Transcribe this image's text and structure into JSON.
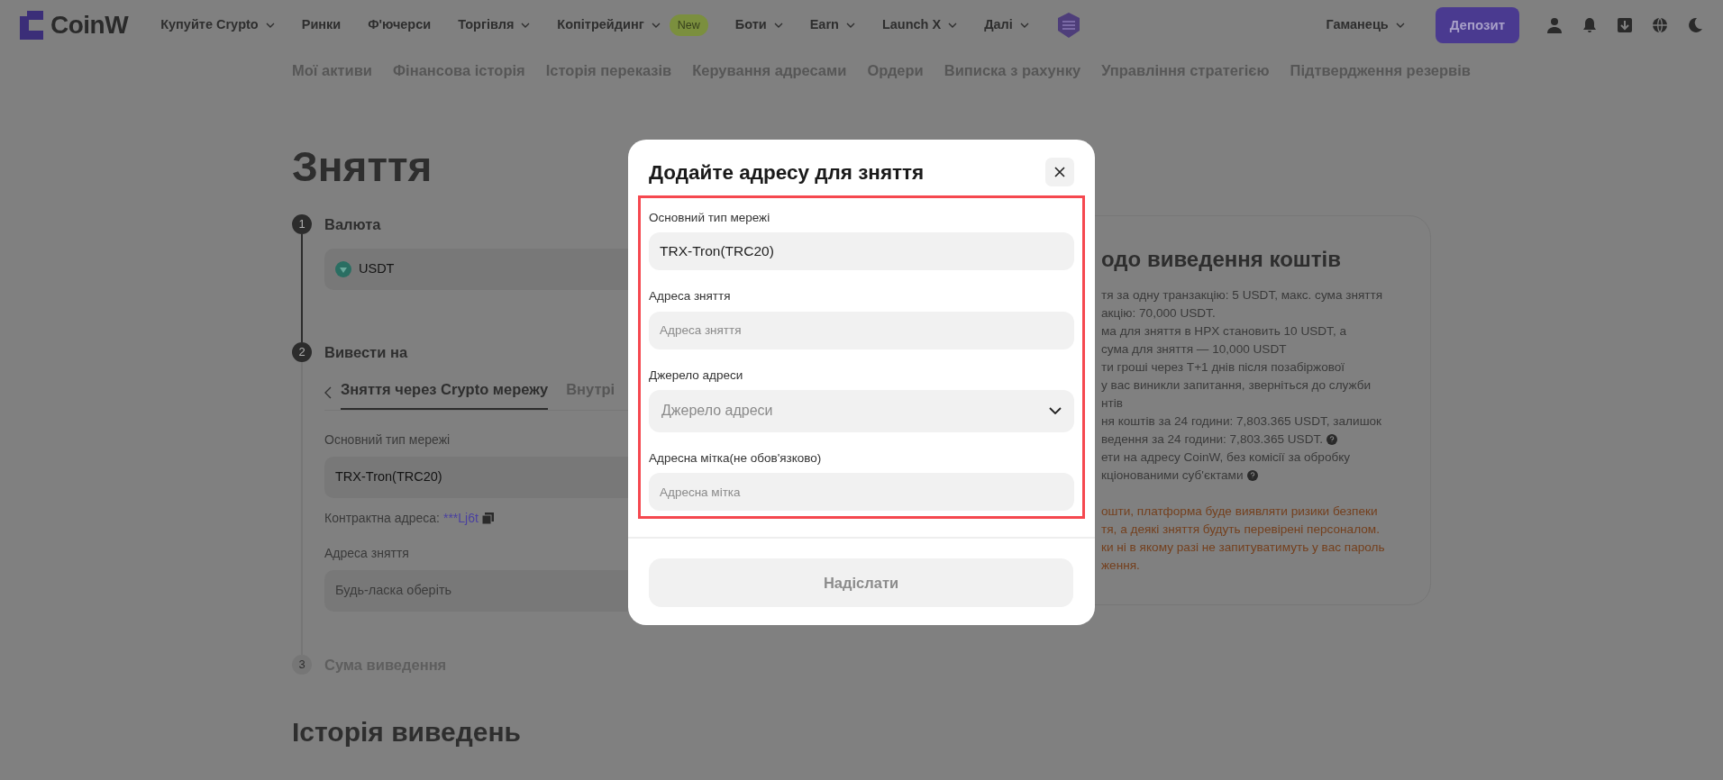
{
  "navbar": {
    "logo": "CoinW",
    "menu": [
      {
        "label": "Купуйте Crypto",
        "dropdown": true
      },
      {
        "label": "Ринки",
        "dropdown": false
      },
      {
        "label": "Ф'ючерси",
        "dropdown": false
      },
      {
        "label": "Торгівля",
        "dropdown": true
      },
      {
        "label": "Копітрейдинг",
        "dropdown": true,
        "badge": "New"
      },
      {
        "label": "Боти",
        "dropdown": true
      },
      {
        "label": "Earn",
        "dropdown": true
      },
      {
        "label": "Launch X",
        "dropdown": true
      },
      {
        "label": "Далі",
        "dropdown": true
      }
    ],
    "wallet": {
      "label": "Гаманець",
      "dropdown": true
    },
    "deposit": "Депозит"
  },
  "subnav": [
    "Мої активи",
    "Фінансова історія",
    "Історія переказів",
    "Керування адресами",
    "Ордери",
    "Виписка з рахунку",
    "Управління стратегією",
    "Підтвердження резервів"
  ],
  "page_title": "Зняття",
  "steps": [
    {
      "number": "1",
      "title": "Валюта",
      "active": true
    },
    {
      "number": "2",
      "title": "Вивести на",
      "active": true
    },
    {
      "number": "3",
      "title": "Сума виведення",
      "active": false
    }
  ],
  "currency": {
    "value": "USDT"
  },
  "withdraw_tabs": [
    {
      "label": "Зняття через Crypto мережу",
      "selected": true
    },
    {
      "label": "Внутрі",
      "selected": false
    }
  ],
  "network": {
    "label": "Основний тип мережі",
    "value": "TRX-Tron(TRC20)"
  },
  "contract": {
    "label": "Контрактна адреса:",
    "value": "***Lj6t"
  },
  "address": {
    "label": "Адреса зняття",
    "placeholder": "Будь-ласка оберіть"
  },
  "info_panel": {
    "title": "одо виведення коштів",
    "lines": [
      {
        "text": "тя за одну транзакцію: 5 USDT, макс. сума зняття",
        "help": false
      },
      {
        "text": "акцію: 70,000 USDT.",
        "help": false
      },
      {
        "text": "ма для зняття в HPX становить 10 USDT, а",
        "help": false
      },
      {
        "text": "сума для зняття — 10,000 USDT",
        "help": false
      },
      {
        "text": "ти гроші через T+1 днів після позабіржової",
        "help": false
      },
      {
        "text": "у вас виникли запитання, зверніться до служби",
        "help": false
      },
      {
        "text": "нтів",
        "help": false
      },
      {
        "text": "ня коштів за 24 години: 7,803.365 USDT, залишок",
        "help": false
      },
      {
        "text": "ведення за 24 години: 7,803.365 USDT.",
        "help": true
      },
      {
        "text": "ети на адресу CoinW, без комісії за обробку",
        "help": false
      },
      {
        "text": "кціонованими суб'єктами",
        "help": true
      }
    ],
    "warnings": [
      "ошти, платформа буде виявляти ризики безпеки",
      "тя, а деякі зняття будуть перевірені персоналом.",
      "ки ні в якому разі не запитуватимуть у вас пароль",
      "ження."
    ]
  },
  "history_title": "Історія виведень",
  "modal": {
    "title": "Додайте адресу для зняття",
    "highlighted": true,
    "fields": [
      {
        "kind": "input",
        "label": "Основний тип мережі",
        "value": "TRX-Tron(TRC20)"
      },
      {
        "kind": "input",
        "label": "Адреса зняття",
        "placeholder": "Адреса зняття"
      },
      {
        "kind": "select",
        "label": "Джерело адреси",
        "placeholder": "Джерело адреси"
      },
      {
        "kind": "input",
        "label": "Адресна мітка(не обов'язково)",
        "placeholder": "Адресна мітка"
      }
    ],
    "submit": {
      "label": "Надіслати",
      "disabled": true
    }
  }
}
